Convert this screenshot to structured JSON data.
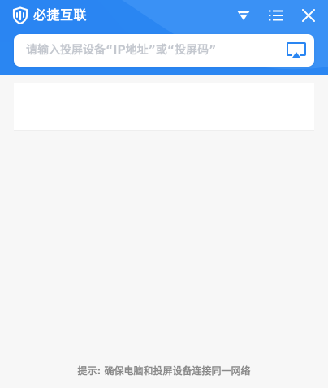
{
  "app": {
    "name": "必捷互联",
    "icons": {
      "logo": "bijie-logo-icon",
      "dropdown": "triangle-down-icon",
      "menu": "list-menu-icon",
      "close": "close-icon",
      "cast": "screen-cast-icon"
    }
  },
  "search": {
    "placeholder": "请输入投屏设备“IP地址”或“投屏码”",
    "value": ""
  },
  "device_list": {
    "items": []
  },
  "footer": {
    "hint": "提示: 确保电脑和投屏设备连接同一网络"
  },
  "colors": {
    "header_bg": "#2a86f2",
    "header_wave": "#4c9cf6",
    "accent": "#2a86f2",
    "page_bg": "#f7f7f7",
    "hint_text": "#8a8a8a",
    "placeholder_text": "#c4c8cf"
  }
}
